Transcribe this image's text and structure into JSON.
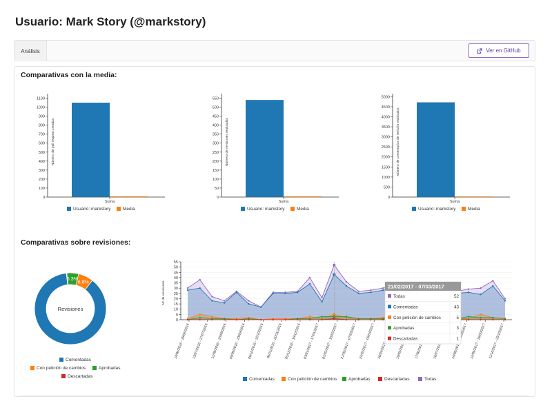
{
  "page": {
    "title": "Usuario: Mark Story (@markstory)"
  },
  "tabs": {
    "active_label": "Análisis"
  },
  "github_button": {
    "label": "Ver en GitHub"
  },
  "sections": {
    "means": "Comparativas con la media:",
    "reviews": "Comparativas sobre revisiones:"
  },
  "colors": {
    "blue": "#1f77b4",
    "orange": "#ff7f0e",
    "green": "#2ca02c",
    "red": "#d62728",
    "purple": "#9467bd",
    "accent": "#6f42c1"
  },
  "chart_data": [
    {
      "type": "bar",
      "categories": [
        "Suma"
      ],
      "series": [
        {
          "name": "Usuario: markstory",
          "values": [
            1050
          ]
        },
        {
          "name": "Media",
          "values": [
            8
          ]
        }
      ],
      "ylabel": "Número de pull request creadas",
      "yticks": [
        0,
        100,
        200,
        300,
        400,
        500,
        600,
        700,
        800,
        900,
        1000,
        1100
      ],
      "ylim": [
        0,
        1150
      ],
      "legend": "bottom"
    },
    {
      "type": "bar",
      "categories": [
        "Suma"
      ],
      "series": [
        {
          "name": "Usuario: markstory",
          "values": [
            540
          ]
        },
        {
          "name": "Media",
          "values": [
            4
          ]
        }
      ],
      "ylabel": "Número de revisiones realizadas",
      "yticks": [
        0,
        50,
        100,
        150,
        200,
        250,
        300,
        350,
        400,
        450,
        500,
        550
      ],
      "ylim": [
        0,
        575
      ],
      "legend": "bottom"
    },
    {
      "type": "bar",
      "categories": [
        "Suma"
      ],
      "series": [
        {
          "name": "Usuario: markstory",
          "values": [
            4720
          ]
        },
        {
          "name": "Media",
          "values": [
            30
          ]
        }
      ],
      "ylabel": "Número de comentarios de revisión realizados",
      "yticks": [
        0,
        500,
        1000,
        1500,
        2000,
        2500,
        3000,
        3500,
        4000,
        4500,
        5000
      ],
      "ylim": [
        0,
        5150
      ],
      "legend": "bottom"
    },
    {
      "type": "pie",
      "center_label": "Revisiones",
      "labels": [
        "Comentadas",
        "Con petición de cambios",
        "Aprobadas",
        "Descartadas"
      ],
      "values": [
        87.7,
        6.8,
        5.3,
        0.2
      ],
      "display_labels": [
        "87.7%",
        "6.8%",
        "5.3%",
        ""
      ],
      "legend": "bottom"
    },
    {
      "type": "area",
      "ylabel": "Nº de revisiones",
      "yticks": [
        0,
        5,
        10,
        15,
        20,
        25,
        30,
        35,
        40,
        45,
        50,
        55
      ],
      "ylim": [
        0,
        55
      ],
      "categories": [
        "14/06/2016 - 28/06/2016",
        "28/06/2016 - 12/07/2016",
        "12/07/2016 - 26/07/2016",
        "26/07/2016 - 09/08/2016",
        "09/08/2016 - 23/08/2016",
        "23/08/2016 - 06/09/2016",
        "06/09/2016 - 20/09/2016",
        "20/09/2016 - 04/10/2016",
        "04/10/2016 - 18/10/2016",
        "18/10/2016 - 01/11/2016",
        "01/11/2016 - 15/11/2016",
        "15/11/2016 - 29/11/2016",
        "29/11/2016 - 13/12/2016",
        "13/12/2016 - 27/12/2016",
        "27/12/2016 - 10/01/2017",
        "10/01/2017 - 24/01/2017",
        "24/01/2017 - 07/02/2017",
        "07/02/2017 - 21/02/2017",
        "21/02/2017 - 07/03/2017",
        "07/03/2017 - 21/03/2017",
        "21/03/2017 - 04/04/2017",
        "04/04/2017 - 18/04/2017",
        "18/04/2017 - 02/05/2017",
        "02/05/2017 - 16/05/2017",
        "16/05/2017 - 30/05/2017",
        "30/05/2017 - 13/06/2017",
        "13/06/2017 - 27/06/2017"
      ],
      "tick_labels": [
        "14/06/2016 - 28/06/2016",
        "13/07/2016 - 27/07/2016",
        "11/08/2016 - 25/08/2016",
        "09/09/2016 - 23/09/2016",
        "08/10/2016 - 22/10/2016",
        "06/11/2016 - 20/11/2016",
        "05/12/2016 - 19/12/2016",
        "03/01/2017 - 17/01/2017",
        "01/02/2017 - 15/02/2017",
        "21/02/2017 - 07/03/2017",
        "22/03/2017 - 05/04/2017",
        "20/04/2017 - 04/05/2017",
        "19/05/2017 - 02/06/2017",
        "17/06/2017 - 01/07/2017",
        "16/07/2017 - 30/07/2017",
        "14/08/2017 - 28/08/2017",
        "12/09/2017 - 26/09/2017",
        "11/10/2017 - 25/10/2017"
      ],
      "series": [
        {
          "name": "Comentadas",
          "values": [
            28,
            30,
            18,
            16,
            26,
            15,
            12,
            25,
            25,
            26,
            34,
            17,
            43,
            32,
            25,
            26,
            28,
            30,
            31,
            27,
            24,
            26,
            25,
            26,
            24,
            32,
            18
          ]
        },
        {
          "name": "Con petición de cambios",
          "values": [
            1,
            5,
            3,
            1,
            1,
            2,
            0,
            1,
            1,
            1,
            3,
            1,
            5,
            2,
            1,
            1,
            2,
            2,
            1,
            1,
            1,
            1,
            1,
            1,
            5,
            2,
            1
          ]
        },
        {
          "name": "Aprobadas",
          "values": [
            0,
            2,
            1,
            1,
            0,
            1,
            0,
            0,
            0,
            1,
            1,
            3,
            3,
            3,
            1,
            1,
            1,
            2,
            1,
            1,
            1,
            1,
            1,
            3,
            2,
            2,
            1
          ]
        },
        {
          "name": "Descartadas",
          "values": [
            0,
            0,
            0,
            0,
            0,
            0,
            0,
            0,
            0,
            0,
            0,
            0,
            1,
            0,
            0,
            0,
            0,
            0,
            0,
            0,
            0,
            0,
            0,
            0,
            0,
            0,
            0
          ]
        },
        {
          "name": "Todas",
          "values": [
            30,
            38,
            22,
            18,
            27,
            18,
            12,
            26,
            26,
            27,
            40,
            21,
            52,
            36,
            27,
            28,
            30,
            33,
            32,
            29,
            26,
            28,
            27,
            29,
            30,
            37,
            20
          ]
        }
      ],
      "tooltip": {
        "title": "21/02/2017 - 07/03/2017",
        "rows": [
          {
            "name": "Todas",
            "value": 52
          },
          {
            "name": "Comentadas",
            "value": 43
          },
          {
            "name": "Con petición de cambios",
            "value": 5
          },
          {
            "name": "Aprobadas",
            "value": 3
          },
          {
            "name": "Descartadas",
            "value": 1
          }
        ]
      },
      "legend": "bottom"
    }
  ]
}
